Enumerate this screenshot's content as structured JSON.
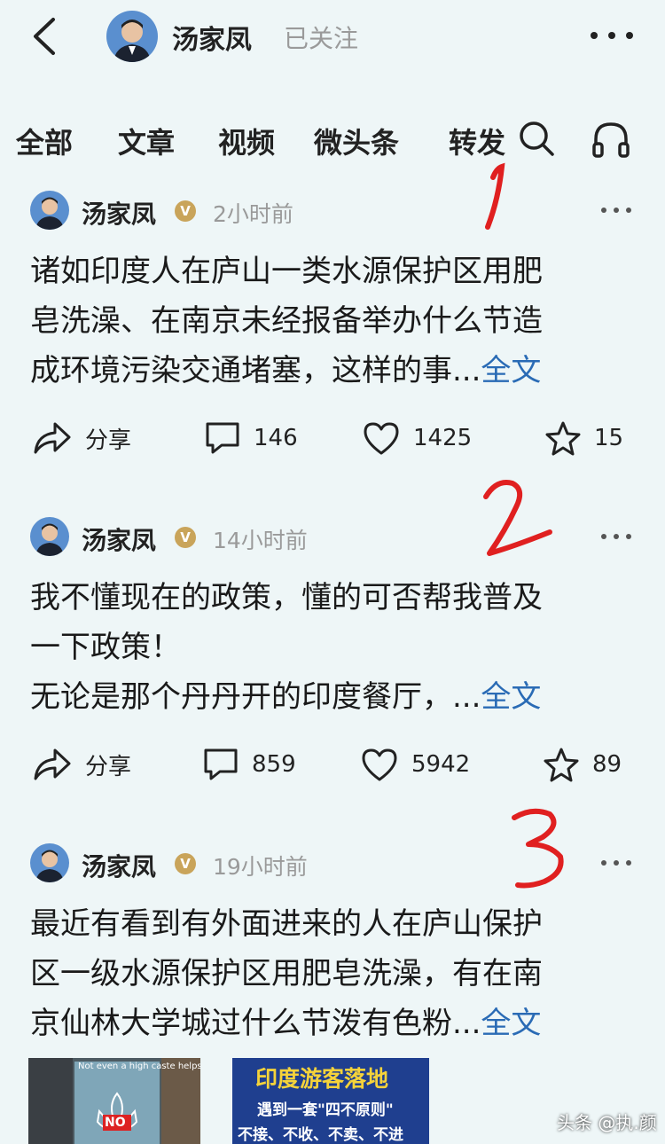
{
  "header": {
    "name": "汤家凤",
    "follow_status": "已关注"
  },
  "tabs": [
    "全部",
    "文章",
    "视频",
    "微头条",
    "转发"
  ],
  "posts": [
    {
      "author": "汤家凤",
      "verified": "V",
      "time": "2小时前",
      "lines": [
        "诸如印度人在庐山一类水源保护区用肥",
        "皂洗澡、在南京未经报备举办什么节造",
        "成环境污染交通堵塞，这样的事..."
      ],
      "full_label": "全文",
      "share_label": "分享",
      "comments": "146",
      "likes": "1425",
      "favorites": "15"
    },
    {
      "author": "汤家凤",
      "verified": "V",
      "time": "14小时前",
      "lines": [
        "我不懂现在的政策，懂的可否帮我普及",
        "一下政策！",
        "无论是那个丹丹开的印度餐厅，..."
      ],
      "full_label": "全文",
      "share_label": "分享",
      "comments": "859",
      "likes": "5942",
      "favorites": "89"
    },
    {
      "author": "汤家凤",
      "verified": "V",
      "time": "19小时前",
      "lines": [
        "最近有看到有外面进来的人在庐山保护",
        "区一级水源保护区用肥皂洗澡，有在南",
        "京仙林大学城过什么节泼有色粉..."
      ],
      "full_label": "全文"
    }
  ],
  "thumbnails": [
    {
      "caption": "Not even a high caste helps",
      "badge": "NO"
    },
    {
      "title": "印度游客落地",
      "subtitle": "遇到一套\"四不原则\"",
      "line3": "不接、不收、不卖、不进"
    }
  ],
  "watermark": "头条 @执.颜",
  "annotations": [
    "1",
    "2",
    "3"
  ],
  "colors": {
    "background": "#eef6f7",
    "link": "#2a6bb5",
    "annotation": "#e02020",
    "badge": "#c9a45a"
  }
}
